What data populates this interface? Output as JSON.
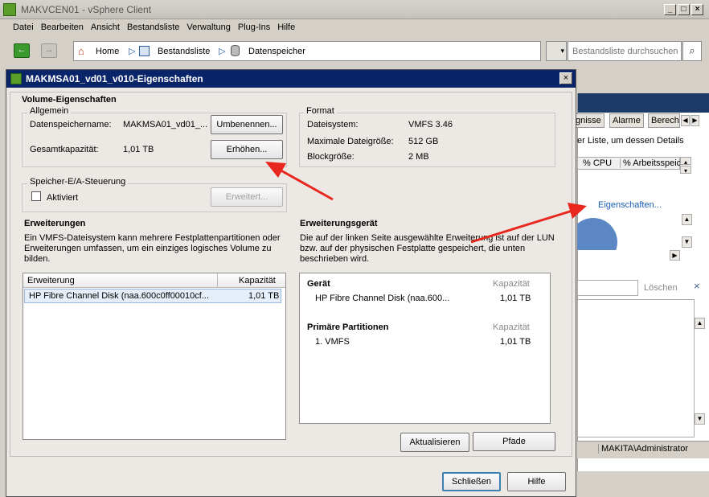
{
  "app": {
    "title": "MAKVCEN01 - vSphere Client",
    "menu": [
      "Datei",
      "Bearbeiten",
      "Ansicht",
      "Bestandsliste",
      "Verwaltung",
      "Plug-Ins",
      "Hilfe"
    ],
    "breadcrumb": {
      "home": "Home",
      "inventory": "Bestandsliste",
      "datastores": "Datenspeicher"
    },
    "search_placeholder": "Bestandsliste durchsuchen",
    "bg": {
      "tabs": [
        "gnisse",
        "Alarme",
        "Berech"
      ],
      "text1": "er Liste, um dessen Details",
      "col_cpu": "% CPU",
      "col_work": "% Arbeitsspeic",
      "link": "Eigenschaften...",
      "clear": "Löschen",
      "status_user": "MAKITA\\Administrator"
    }
  },
  "dialog": {
    "title": "MAKMSA01_vd01_v010-Eigenschaften",
    "volume_heading": "Volume-Eigenschaften",
    "general": {
      "legend": "Allgemein",
      "name_label": "Datenspeichername:",
      "name_value": "MAKMSA01_vd01_...",
      "rename": "Umbenennen...",
      "capacity_label": "Gesamtkapazität:",
      "capacity_value": "1,01 TB",
      "increase": "Erhöhen..."
    },
    "format": {
      "legend": "Format",
      "fs_label": "Dateisystem:",
      "fs_value": "VMFS 3.46",
      "maxfile_label": "Maximale Dateigröße:",
      "maxfile_value": "512 GB",
      "block_label": "Blockgröße:",
      "block_value": "2 MB"
    },
    "io": {
      "legend": "Speicher-E/A-Steuerung",
      "checkbox": "Aktiviert",
      "advanced": "Erweitert..."
    },
    "extents": {
      "heading": "Erweiterungen",
      "desc": "Ein VMFS-Dateisystem kann mehrere Festplattenpartitionen oder Erweiterungen umfassen, um ein einziges logisches Volume zu bilden.",
      "col_extent": "Erweiterung",
      "col_capacity": "Kapazität",
      "rows": [
        {
          "name": "HP Fibre Channel Disk (naa.600c0ff00010cf...",
          "capacity": "1,01 TB"
        }
      ]
    },
    "device": {
      "heading": "Erweiterungsgerät",
      "desc": "Die auf der linken Seite ausgewählte Erweiterung ist auf der LUN bzw. auf der physischen Festplatte gespeichert, die unten beschrieben wird.",
      "device_label": "Gerät",
      "capacity_label": "Kapazität",
      "device_name": "HP Fibre Channel Disk (naa.600...",
      "device_capacity": "1,01 TB",
      "partitions_label": "Primäre Partitionen",
      "partition_capacity_label": "Kapazität",
      "partition_name": "1. VMFS",
      "partition_capacity": "1,01 TB",
      "refresh": "Aktualisieren",
      "paths": "Pfade"
    },
    "close": "Schließen",
    "help": "Hilfe"
  },
  "colors": {
    "titlebar": "#0a246a",
    "arrow": "#e8281e",
    "link": "#1a5fb4"
  }
}
